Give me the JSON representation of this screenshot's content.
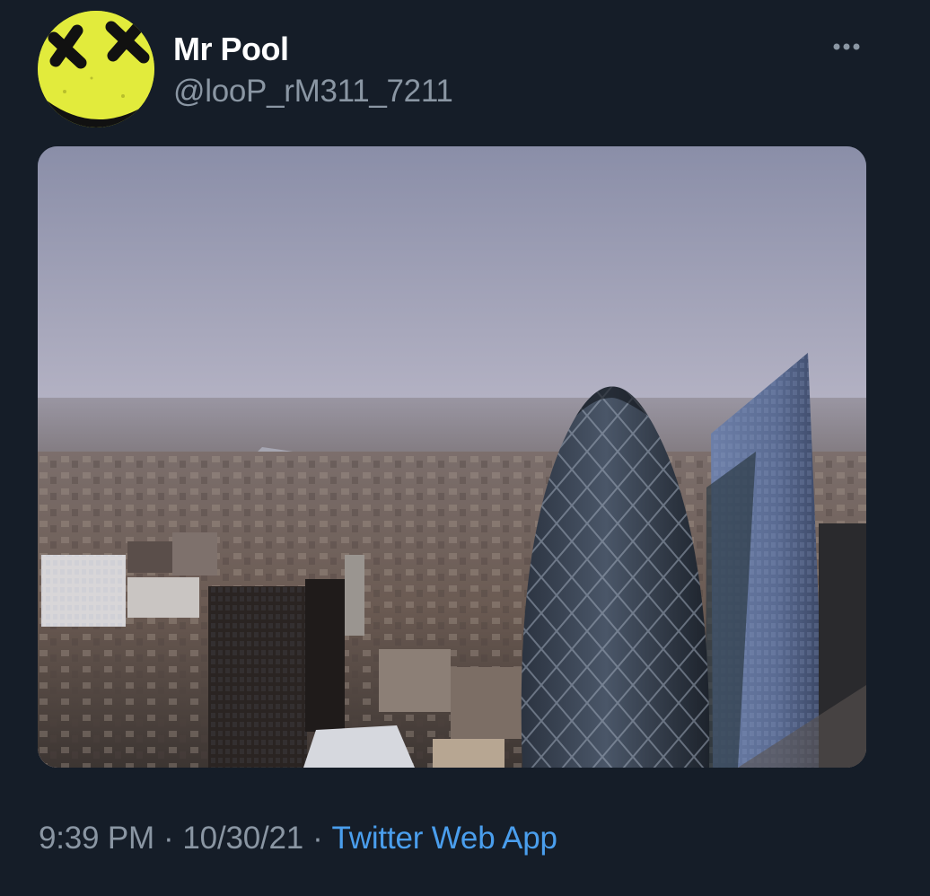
{
  "tweet": {
    "display_name": "Mr Pool",
    "handle": "@looP_rM311_7211",
    "time": "9:39 PM",
    "date": "10/30/21",
    "separator": "·",
    "source": "Twitter Web App",
    "more_icon": "more-horizontal-icon",
    "avatar_icon": "yellow-smiley-x-eyes-icon",
    "media_subject": "city-skyline-photo"
  },
  "colors": {
    "background": "#151d28",
    "name": "#ffffff",
    "secondary_text": "#8a96a3",
    "link": "#4a9eed",
    "avatar_yellow": "#e2eb3c"
  }
}
